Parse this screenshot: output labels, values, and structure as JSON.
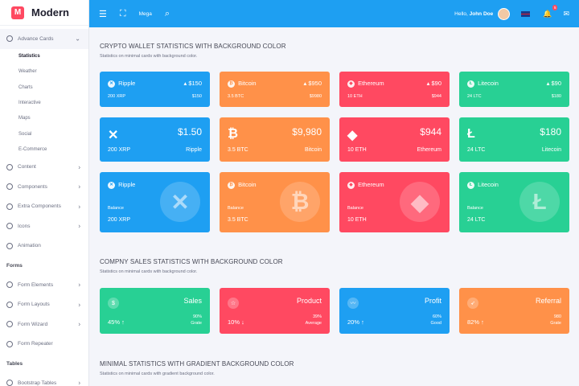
{
  "brand": {
    "logo_letter": "M",
    "name": "Modern"
  },
  "sidebar": {
    "open_item": {
      "icon": "cards-icon",
      "label": "Advance Cards"
    },
    "sub_items": [
      "Statistics",
      "Weather",
      "Charts",
      "Interactive",
      "Maps",
      "Social",
      "E-Commerce"
    ],
    "items": [
      {
        "icon": "content-icon",
        "label": "Content"
      },
      {
        "icon": "components-icon",
        "label": "Components"
      },
      {
        "icon": "extra-components-icon",
        "label": "Extra Components"
      },
      {
        "icon": "eye-icon",
        "label": "Icons"
      },
      {
        "icon": "animation-icon",
        "label": "Animation"
      }
    ],
    "header_forms": "Forms",
    "form_items": [
      {
        "icon": "form-elements-icon",
        "label": "Form Elements"
      },
      {
        "icon": "form-layouts-icon",
        "label": "Form Layouts"
      },
      {
        "icon": "form-wizard-icon",
        "label": "Form Wizard"
      },
      {
        "icon": "form-repeater-icon",
        "label": "Form Repeater"
      }
    ],
    "header_tables": "Tables",
    "table_items": [
      {
        "icon": "table-icon",
        "label": "Bootstrap Tables"
      }
    ]
  },
  "topbar": {
    "mega": "Mega",
    "hello": "Hello,",
    "user": "John Doe",
    "notification_count": "5"
  },
  "section1": {
    "title": "CRYPTO WALLET STATISTICS WITH BACKGROUND COLOR",
    "subtitle": "Statistics on minimal cards with background color."
  },
  "row1": [
    {
      "name": "Ripple",
      "value": "$150",
      "holding": "200 XRP",
      "worth": "$150"
    },
    {
      "name": "Bitcoin",
      "value": "$950",
      "holding": "3.5 BTC",
      "worth": "$9980"
    },
    {
      "name": "Ethereum",
      "value": "$90",
      "holding": "10 ETH",
      "worth": "$944"
    },
    {
      "name": "Litecoin",
      "value": "$90",
      "holding": "24 LTC",
      "worth": "$180"
    }
  ],
  "row2": [
    {
      "value": "$1.50",
      "holding": "200 XRP",
      "name": "Ripple"
    },
    {
      "value": "$9,980",
      "holding": "3.5 BTC",
      "name": "Bitcoin"
    },
    {
      "value": "$944",
      "holding": "10 ETH",
      "name": "Ethereum"
    },
    {
      "value": "$180",
      "holding": "24 LTC",
      "name": "Litecoin"
    }
  ],
  "row3": [
    {
      "name": "Ripple",
      "balance_label": "Balance",
      "holding": "200 XRP"
    },
    {
      "name": "Bitcoin",
      "balance_label": "Balance",
      "holding": "3.5 BTC"
    },
    {
      "name": "Ethereum",
      "balance_label": "Balance",
      "holding": "10 ETH"
    },
    {
      "name": "Litecoin",
      "balance_label": "Balance",
      "holding": "24 LTC"
    }
  ],
  "section2": {
    "title": "COMPNY SALES STATISTICS WITH BACKGROUND COLOR",
    "subtitle": "Statistics on minimal cards with background color."
  },
  "sales": [
    {
      "title": "Sales",
      "pct": "45%",
      "trend": "↑",
      "rv_value": "90%",
      "rv_label": "Grate"
    },
    {
      "title": "Product",
      "pct": "10%",
      "trend": "↓",
      "rv_value": "39%",
      "rv_label": "Average"
    },
    {
      "title": "Profit",
      "pct": "20%",
      "trend": "↑",
      "rv_value": "60%",
      "rv_label": "Good"
    },
    {
      "title": "Referral",
      "pct": "82%",
      "trend": "↑",
      "rv_value": "980",
      "rv_label": "Grate"
    }
  ],
  "section3": {
    "title": "MINIMAL STATISTICS WITH GRADIENT BACKGROUND COLOR",
    "subtitle": "Statistics on minimal cards with gradient background color."
  }
}
